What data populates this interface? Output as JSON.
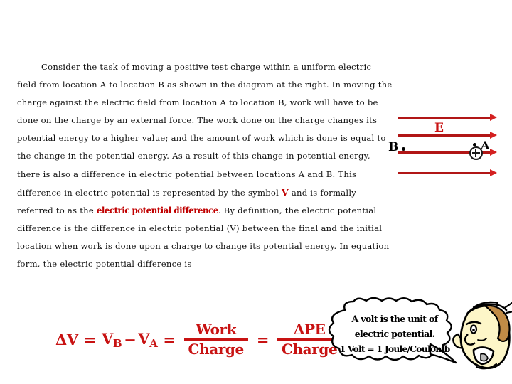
{
  "slide": {
    "background_color": "#ffffff",
    "accent_red": "#c81212",
    "line_red": "#b11616"
  },
  "body": {
    "segments": [
      {
        "type": "text",
        "value": "Consider the task of moving a positive test charge within a uniform electric field from location A to location B as shown in the diagram at the right. In moving the charge against the electric field from location A to location B, work will have to be done on the charge by an external force. The work done on the charge changes its potential energy to a higher value; and the amount of work which is done is equal to the change in the potential energy. As a result of this change in potential energy, there is also a difference in electric potential between locations A and B. This difference in electric potential is represented by the symbol "
      },
      {
        "type": "emph-v",
        "value": "V"
      },
      {
        "type": "text",
        "value": " and is formally referred to as the "
      },
      {
        "type": "emph-term",
        "value": "electric potential difference"
      },
      {
        "type": "text",
        "value": ". By definition, the electric potential difference is the difference in electric potential (V) between the final and the initial location when work is done upon a charge to change its potential energy. In equation form, the electric potential difference is"
      }
    ]
  },
  "diagram": {
    "field_label": "E",
    "point_b_label": "B",
    "point_a_label": "A",
    "field_line_count": 4,
    "field_direction": "right",
    "test_charge_sign": "+"
  },
  "equation": {
    "delta_v": "ΔV",
    "equals_1": "=",
    "v_b": "V",
    "v_b_sub": "B",
    "minus": "−",
    "v_a": "V",
    "v_a_sub": "A",
    "equals_2": "=",
    "frac1_num": "Work",
    "frac1_den": "Charge",
    "equals_3": "=",
    "frac2_num": "ΔPE",
    "frac2_den": "Charge"
  },
  "bubble": {
    "line1": "A volt is the unit of",
    "line2": "electric potential.",
    "line3": "1 Volt = 1 Joule/Coulomb"
  },
  "character": {
    "description": "cartoon-talking-head"
  }
}
